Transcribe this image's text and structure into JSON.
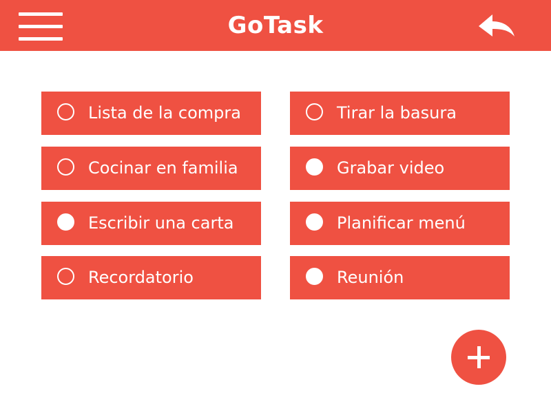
{
  "header": {
    "title": "GoTask",
    "menu_icon": "hamburger-menu-icon",
    "back_icon": "reply-arrow-icon",
    "background_color": "#ef5142"
  },
  "tasks": [
    {
      "label": "Lista de la compra",
      "done": false
    },
    {
      "label": "Tirar la basura",
      "done": false
    },
    {
      "label": "Cocinar en familia",
      "done": false
    },
    {
      "label": "Grabar video",
      "done": true
    },
    {
      "label": "Escribir una carta",
      "done": true
    },
    {
      "label": "Planificar menú",
      "done": true
    },
    {
      "label": "Recordatorio",
      "done": false
    },
    {
      "label": "Reunión",
      "done": true
    }
  ],
  "fab": {
    "icon": "plus-icon"
  },
  "colors": {
    "accent": "#ef5142",
    "text_on_accent": "#ffffff",
    "background": "#ffffff"
  }
}
